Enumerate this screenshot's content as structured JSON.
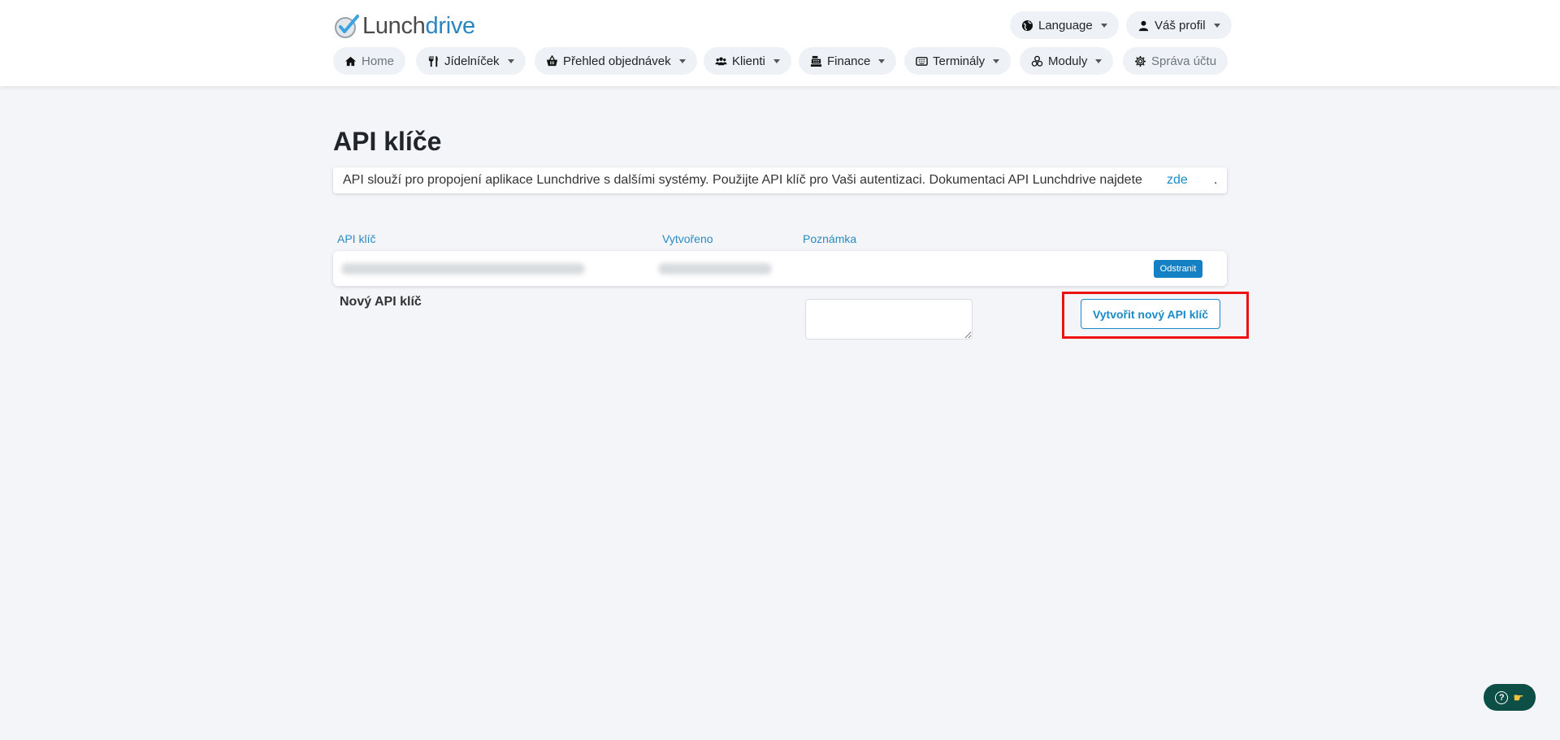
{
  "brand": {
    "part1": "Lunch",
    "part2": "drive"
  },
  "topbar": {
    "language_label": "Language",
    "profile_label": "Váš profil"
  },
  "nav": {
    "items": [
      {
        "label": "Home",
        "icon": "home-icon"
      },
      {
        "label": "Jídelníček",
        "icon": "cutlery-icon"
      },
      {
        "label": "Přehled objednávek",
        "icon": "basket-icon"
      },
      {
        "label": "Klienti",
        "icon": "users-icon"
      },
      {
        "label": "Finance",
        "icon": "cash-register-icon"
      },
      {
        "label": "Terminály",
        "icon": "terminal-icon"
      },
      {
        "label": "Moduly",
        "icon": "modules-icon"
      },
      {
        "label": "Správa účtu",
        "icon": "gear-icon"
      }
    ]
  },
  "page": {
    "title": "API klíče",
    "info_text": "API slouží pro propojení aplikace Lunchdrive s dalšími systémy. Použijte API klíč pro Vaši autentizaci. Dokumentaci API Lunchdrive najdete",
    "info_link": "zde",
    "info_end": "."
  },
  "table": {
    "headers": {
      "key": "API klíč",
      "created": "Vytvořeno",
      "note": "Poznámka"
    },
    "rows": [
      {
        "delete_label": "Odstranit"
      }
    ]
  },
  "new_key": {
    "label": "Nový API klíč",
    "note_value": "",
    "create_label": "Vytvořit nový API klíč"
  },
  "colors": {
    "accent": "#1a8bc7",
    "highlight": "#ee1111",
    "help_widget": "#0d4f47"
  }
}
